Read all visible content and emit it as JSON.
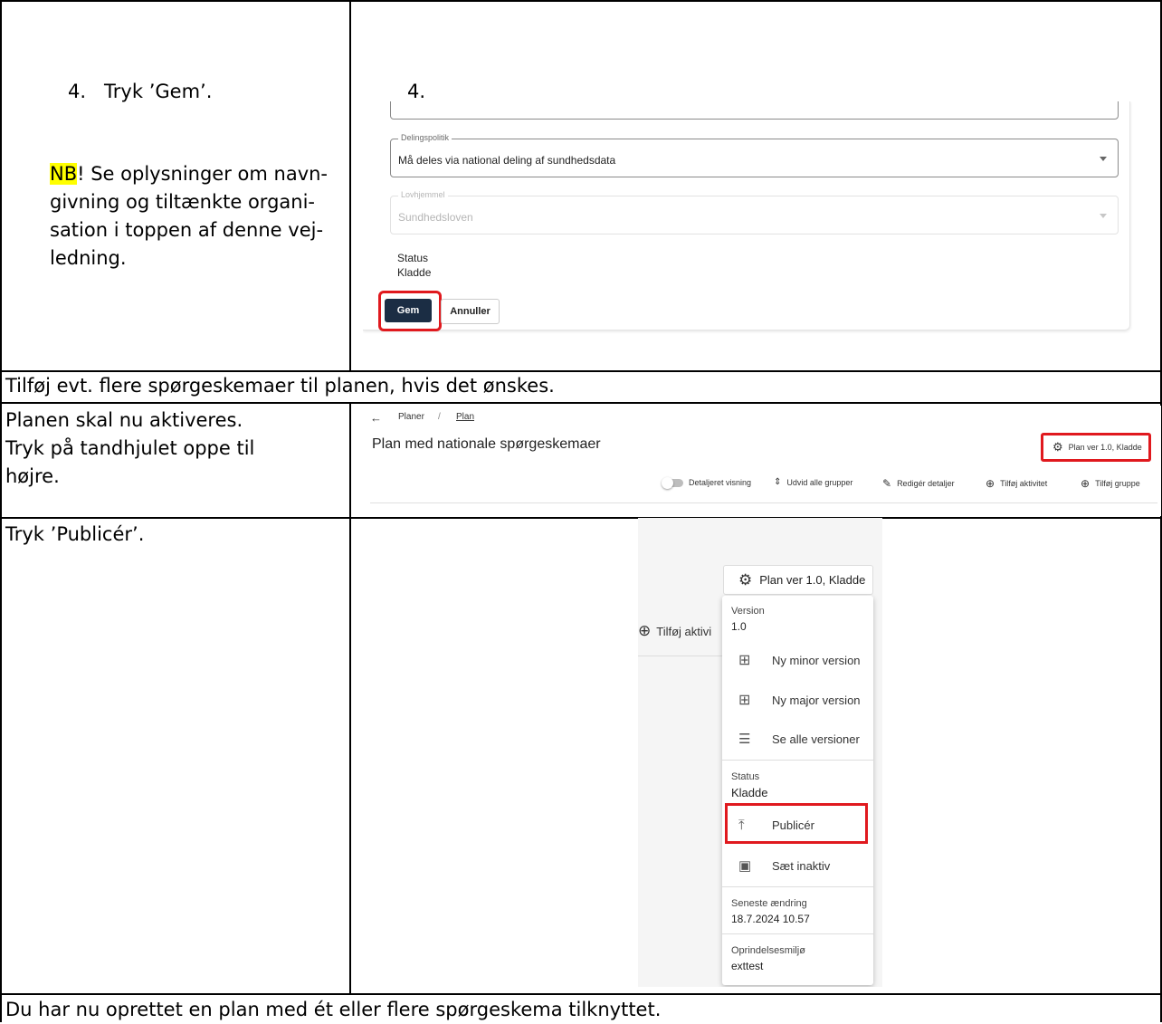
{
  "row1": {
    "step_text": "4.   Tryk ’Gem’.",
    "right_number": "4.",
    "nb_label": "NB",
    "nb_lines": [
      "! Se oplysninger om navn-",
      "givning og tiltænkte organi-",
      "sation i toppen af denne vej-",
      "ledning."
    ]
  },
  "form": {
    "sharing_label": "Delingspolitik",
    "sharing_value": "Må deles via national deling af sundhedsdata",
    "law_label": "Lovhjemmel",
    "law_value": "Sundhedsloven",
    "status_label": "Status",
    "status_value": "Kladde",
    "save_button": "Gem",
    "cancel_button": "Annuller"
  },
  "row2": {
    "text": "Tilføj evt. flere spørgeskemaer til planen, hvis det ønskes."
  },
  "row3": {
    "lines": [
      "Planen skal nu aktiveres.",
      "Tryk på tandhjulet oppe til",
      "højre."
    ]
  },
  "toolbar": {
    "crumb_root": "Planer",
    "crumb_sep": "/",
    "crumb_current": "Plan",
    "title": "Plan med nationale spørgeskemaer",
    "version_button": "Plan ver 1.0, Kladde",
    "detailed_view": "Detaljeret visning",
    "expand_groups": "Udvid alle grupper",
    "edit_details": "Redigér detaljer",
    "add_activity": "Tilføj aktivitet",
    "add_group": "Tilføj gruppe"
  },
  "row4": {
    "text": "Tryk ’Publicér’."
  },
  "menu": {
    "button": "Plan ver 1.0, Kladde",
    "bg_add_activity": "Tilføj aktivi",
    "version_label": "Version",
    "version_value": "1.0",
    "new_minor": "Ny minor version",
    "new_major": "Ny major version",
    "all_versions": "Se alle versioner",
    "status_label": "Status",
    "status_value": "Kladde",
    "publish": "Publicér",
    "deactivate": "Sæt inaktiv",
    "last_changed_label": "Seneste ændring",
    "last_changed_value": "18.7.2024 10.57",
    "origin_label": "Oprindelsesmiljø",
    "origin_value": "exttest"
  },
  "footer": {
    "text": "Du har nu oprettet en plan med ét eller flere spørgeskema tilknyttet."
  },
  "colors": {
    "highlight": "#ffff00",
    "primary_button": "#1b2d44",
    "red_box": "#e0191e"
  }
}
